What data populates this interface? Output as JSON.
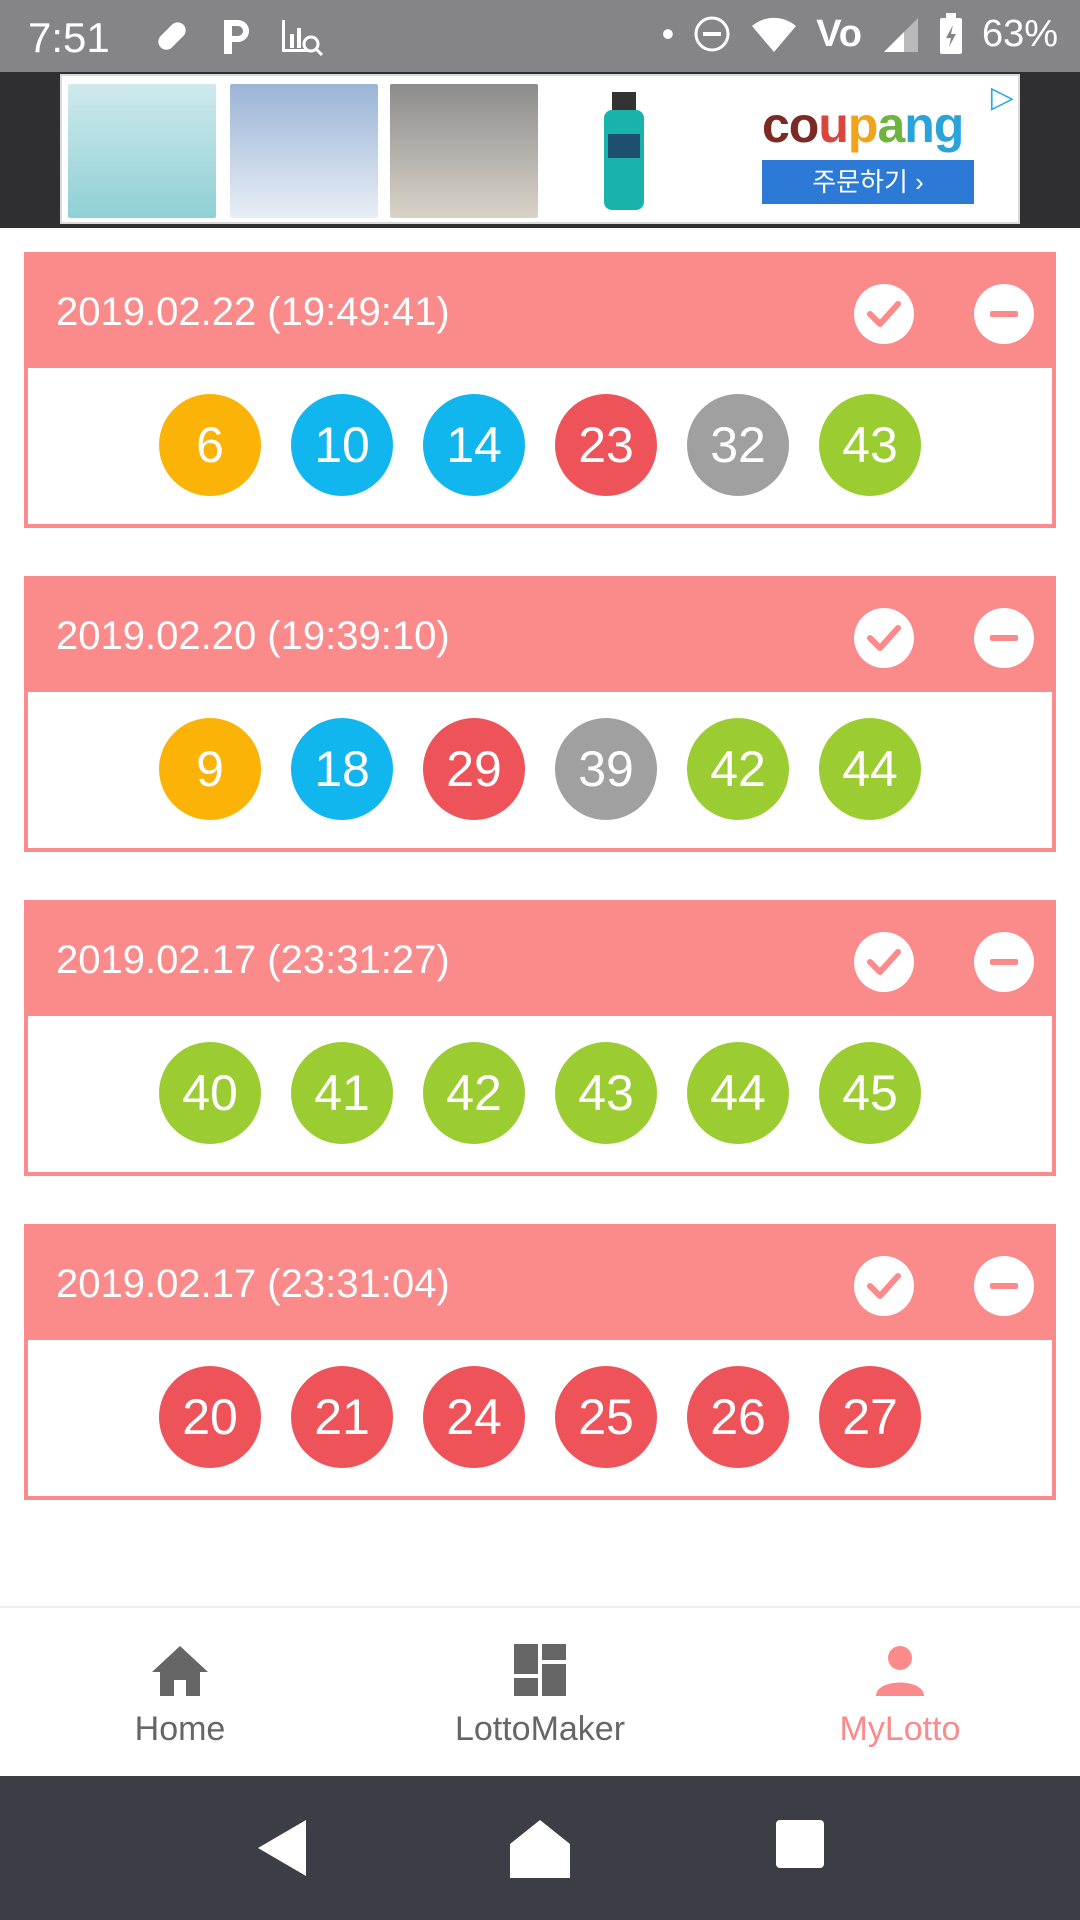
{
  "status_bar": {
    "time": "7:51",
    "battery": "63%"
  },
  "ad": {
    "brand_parts": [
      "co",
      "u",
      "p",
      "a",
      "ng"
    ],
    "order_label": "주문하기 ›"
  },
  "tickets": [
    {
      "date": "2019.02.22 (19:49:41)",
      "numbers": [
        {
          "n": "6",
          "color": "#fbb308"
        },
        {
          "n": "10",
          "color": "#12b6ef"
        },
        {
          "n": "14",
          "color": "#12b6ef"
        },
        {
          "n": "23",
          "color": "#ee5359"
        },
        {
          "n": "32",
          "color": "#a0a0a0"
        },
        {
          "n": "43",
          "color": "#9bcd32"
        }
      ]
    },
    {
      "date": "2019.02.20 (19:39:10)",
      "numbers": [
        {
          "n": "9",
          "color": "#fbb308"
        },
        {
          "n": "18",
          "color": "#12b6ef"
        },
        {
          "n": "29",
          "color": "#ee5359"
        },
        {
          "n": "39",
          "color": "#a0a0a0"
        },
        {
          "n": "42",
          "color": "#9bcd32"
        },
        {
          "n": "44",
          "color": "#9bcd32"
        }
      ]
    },
    {
      "date": "2019.02.17 (23:31:27)",
      "numbers": [
        {
          "n": "40",
          "color": "#9bcd32"
        },
        {
          "n": "41",
          "color": "#9bcd32"
        },
        {
          "n": "42",
          "color": "#9bcd32"
        },
        {
          "n": "43",
          "color": "#9bcd32"
        },
        {
          "n": "44",
          "color": "#9bcd32"
        },
        {
          "n": "45",
          "color": "#9bcd32"
        }
      ]
    },
    {
      "date": "2019.02.17 (23:31:04)",
      "numbers": [
        {
          "n": "20",
          "color": "#ee5359"
        },
        {
          "n": "21",
          "color": "#ee5359"
        },
        {
          "n": "24",
          "color": "#ee5359"
        },
        {
          "n": "25",
          "color": "#ee5359"
        },
        {
          "n": "26",
          "color": "#ee5359"
        },
        {
          "n": "27",
          "color": "#ee5359"
        }
      ]
    }
  ],
  "nav": {
    "home": "Home",
    "maker": "LottoMaker",
    "mylotto": "MyLotto",
    "active_color": "#fb8a8b",
    "inactive_color": "#666666"
  }
}
